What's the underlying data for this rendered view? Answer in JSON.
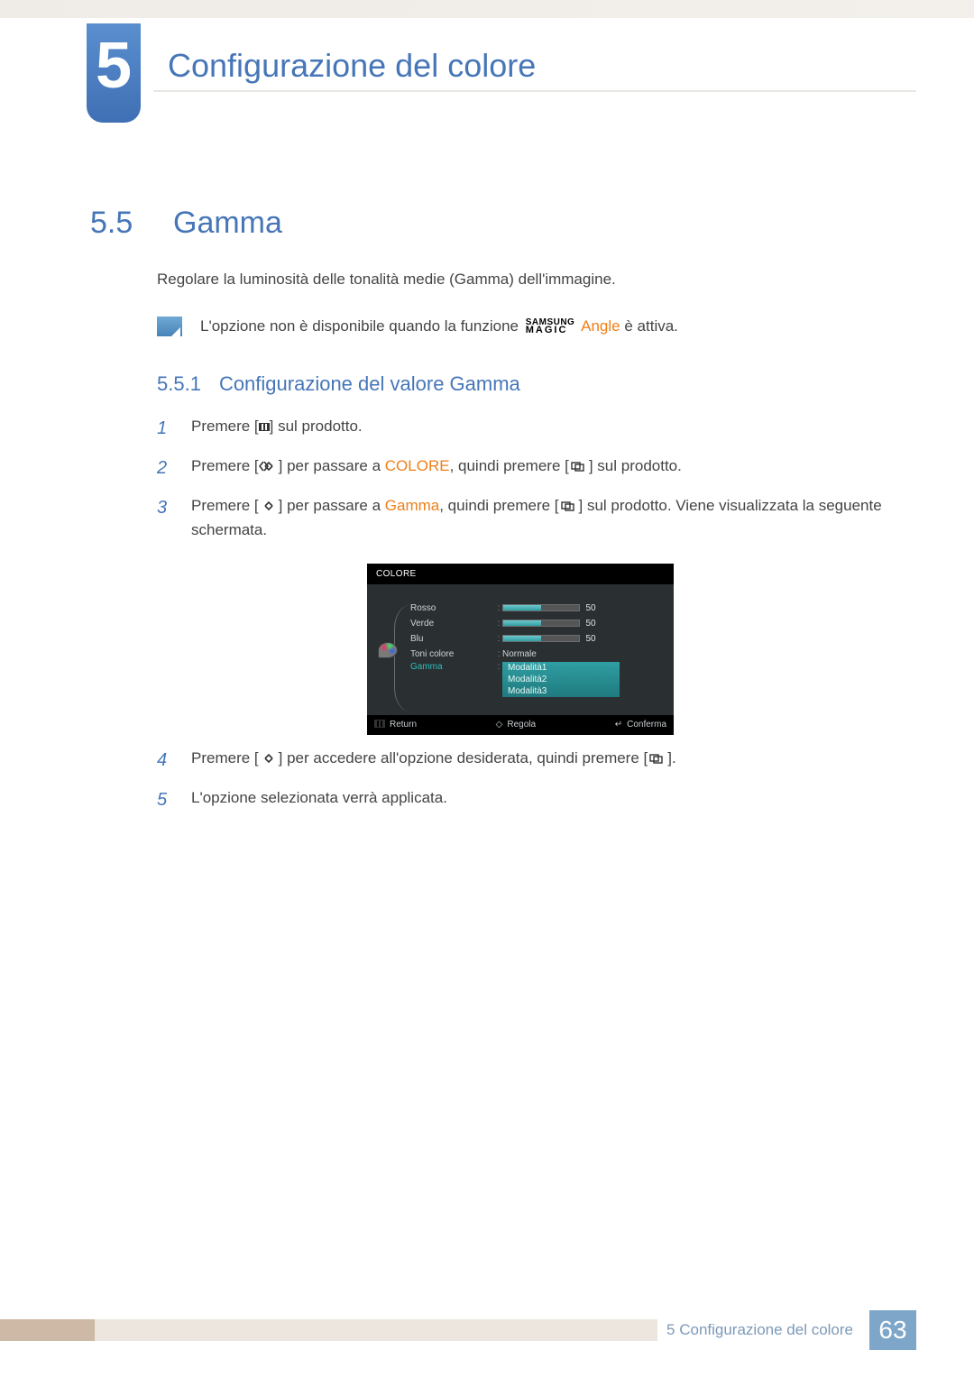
{
  "chapter": {
    "number": "5",
    "title": "Configurazione del colore"
  },
  "section": {
    "number": "5.5",
    "title": "Gamma"
  },
  "intro": "Regolare la luminosità delle tonalità medie (Gamma) dell'immagine.",
  "note": {
    "prefix": "L'opzione non è disponibile quando la funzione",
    "magic_top": "SAMSUNG",
    "magic_bottom": "MAGIC",
    "angle": "Angle",
    "suffix": "è attiva."
  },
  "subsection": {
    "number": "5.5.1",
    "title": "Configurazione del valore Gamma"
  },
  "steps": {
    "1": {
      "pre": "Premere [",
      "post": "] sul prodotto."
    },
    "2": {
      "pre": "Premere [",
      "mid1": "] per passare a ",
      "kw": "COLORE",
      "mid2": ", quindi premere [",
      "post": "] sul prodotto."
    },
    "3": {
      "pre": "Premere [",
      "mid1": "] per passare a ",
      "kw": "Gamma",
      "mid2": ", quindi premere [",
      "post": "] sul prodotto. Viene visualizzata la seguente schermata."
    },
    "4": {
      "pre": "Premere [",
      "mid": "] per accedere all'opzione desiderata, quindi premere [",
      "post": "]."
    },
    "5": {
      "text": "L'opzione selezionata verrà applicata."
    }
  },
  "osd": {
    "title": "COLORE",
    "rows": {
      "rosso": {
        "label": "Rosso",
        "value": "50"
      },
      "verde": {
        "label": "Verde",
        "value": "50"
      },
      "blu": {
        "label": "Blu",
        "value": "50"
      },
      "toni": {
        "label": "Toni colore",
        "value": "Normale"
      },
      "gamma": {
        "label": "Gamma",
        "opt1": "Modalità1",
        "opt2": "Modalità2",
        "opt3": "Modalità3"
      }
    },
    "footer": {
      "return": "Return",
      "adjust": "Regola",
      "confirm": "Conferma"
    }
  },
  "footer": {
    "text": "5 Configurazione del colore",
    "page": "63"
  }
}
